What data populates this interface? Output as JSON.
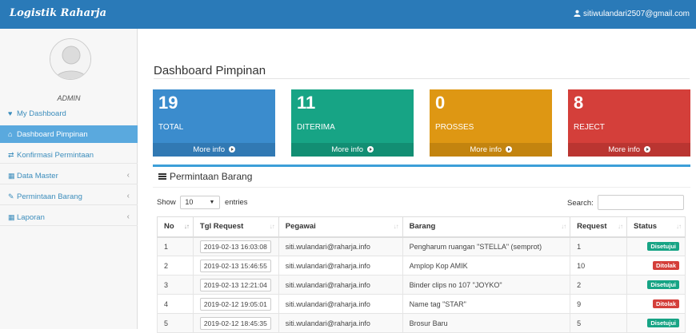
{
  "app": {
    "brand": "Logistik Raharja",
    "user_email": "sitiwulandari2507@gmail.com"
  },
  "sidebar": {
    "role": "ADMIN",
    "items": [
      {
        "label": "My Dashboard",
        "icon": "heart-icon"
      },
      {
        "label": "Dashboard Pimpinan",
        "icon": "home-icon"
      },
      {
        "label": "Konfirmasi Permintaan",
        "icon": "exchange-icon"
      },
      {
        "label": "Data Master",
        "icon": "grid-icon"
      },
      {
        "label": "Permintaan Barang",
        "icon": "edit-icon"
      },
      {
        "label": "Laporan",
        "icon": "grid-icon"
      }
    ]
  },
  "page": {
    "title": "Dashboard Pimpinan"
  },
  "stats": [
    {
      "value": "19",
      "label": "TOTAL",
      "more": "More info",
      "color": "#3b8ccd"
    },
    {
      "value": "11",
      "label": "DITERIMA",
      "more": "More info",
      "color": "#17a485"
    },
    {
      "value": "0",
      "label": "PROSSES",
      "more": "More info",
      "color": "#de9713"
    },
    {
      "value": "8",
      "label": "REJECT",
      "more": "More info",
      "color": "#d43f3a"
    }
  ],
  "panel": {
    "title": "Permintaan Barang",
    "show_label": "Show",
    "entries_value": "10",
    "entries_label": "entries",
    "search_label": "Search:"
  },
  "table": {
    "headers": [
      "No",
      "Tgl Request",
      "Pegawai",
      "Barang",
      "Request",
      "Status"
    ],
    "rows": [
      [
        "1",
        "2019-02-13 16:03:08",
        "siti.wulandari@raharja.info",
        "Pengharum ruangan \"STELLA\" (semprot)",
        "1",
        "Disetujui"
      ],
      [
        "2",
        "2019-02-13 15:46:55",
        "siti.wulandari@raharja.info",
        "Amplop Kop AMIK",
        "10",
        "Ditolak"
      ],
      [
        "3",
        "2019-02-13 12:21:04",
        "siti.wulandari@raharja.info",
        "Binder clips no 107 \"JOYKO\"",
        "2",
        "Disetujui"
      ],
      [
        "4",
        "2019-02-12 19:05:01",
        "siti.wulandari@raharja.info",
        "Name tag \"STAR\"",
        "9",
        "Ditolak"
      ],
      [
        "5",
        "2019-02-12 18:45:35",
        "siti.wulandari@raharja.info",
        "Brosur Baru",
        "5",
        "Disetujui"
      ]
    ]
  },
  "colors": {
    "topbar": "#2a7ab8",
    "active_nav": "#5aa9de",
    "approved": "#17a485",
    "rejected": "#d43f3a"
  }
}
